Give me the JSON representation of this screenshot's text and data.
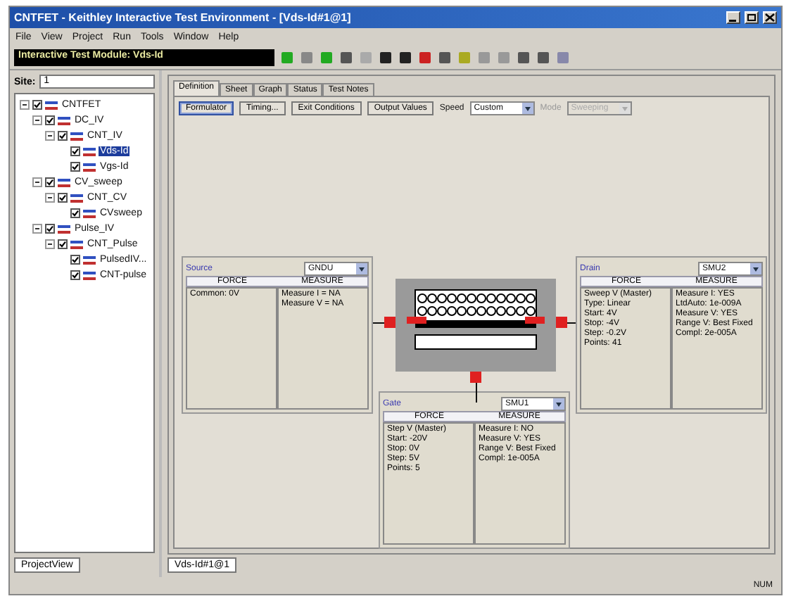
{
  "window": {
    "title": "CNTFET - Keithley Interactive Test Environment - [Vds-Id#1@1]"
  },
  "menu": [
    "File",
    "View",
    "Project",
    "Run",
    "Tools",
    "Window",
    "Help"
  ],
  "toolbar": {
    "module_label": "Interactive Test Module: Vds-Id"
  },
  "sidebar": {
    "site_label": "Site:",
    "site_value": "1",
    "tree": [
      {
        "label": "CNTFET",
        "checked": true,
        "expanded": true,
        "selected": false,
        "children": [
          {
            "label": "DC_IV",
            "checked": true,
            "expanded": true,
            "selected": false,
            "children": [
              {
                "label": "CNT_IV",
                "checked": true,
                "expanded": true,
                "selected": false,
                "children": [
                  {
                    "label": "Vds-Id",
                    "checked": true,
                    "selected": true
                  },
                  {
                    "label": "Vgs-Id",
                    "checked": true,
                    "selected": false
                  }
                ]
              }
            ]
          },
          {
            "label": "CV_sweep",
            "checked": true,
            "expanded": true,
            "selected": false,
            "children": [
              {
                "label": "CNT_CV",
                "checked": true,
                "expanded": true,
                "selected": false,
                "children": [
                  {
                    "label": "CVsweep",
                    "checked": true,
                    "selected": false
                  }
                ]
              }
            ]
          },
          {
            "label": "Pulse_IV",
            "checked": true,
            "expanded": true,
            "selected": false,
            "children": [
              {
                "label": "CNT_Pulse",
                "checked": true,
                "expanded": true,
                "selected": false,
                "children": [
                  {
                    "label": "PulsedIV...",
                    "checked": true,
                    "selected": false
                  },
                  {
                    "label": "CNT-pulse",
                    "checked": true,
                    "selected": false
                  }
                ]
              }
            ]
          }
        ]
      }
    ],
    "tab": "ProjectView"
  },
  "module": {
    "tabs": [
      {
        "label": "Definition",
        "selected": true
      },
      {
        "label": "Sheet",
        "selected": false
      },
      {
        "label": "Graph",
        "selected": false
      },
      {
        "label": "Status",
        "selected": false
      },
      {
        "label": "Test Notes",
        "selected": false
      }
    ],
    "buttons": [
      {
        "label": "Formulator",
        "selected": true
      },
      {
        "label": "Timing...",
        "selected": false
      },
      {
        "label": "Exit Conditions",
        "selected": false
      },
      {
        "label": "Output Values",
        "selected": false
      }
    ],
    "speed": {
      "label": "Speed",
      "value": "Custom"
    },
    "mode": {
      "label": "Mode",
      "value": "Sweeping",
      "disabled": true
    },
    "instruments": [
      {
        "kind": "source",
        "name": "Source",
        "unit": "GNDU",
        "force_header": "FORCE",
        "measure_header": "MEASURE",
        "force_lines": [
          "Common: 0V"
        ],
        "measure_lines": [
          "Measure I = NA",
          "Measure V = NA"
        ]
      },
      {
        "kind": "drain",
        "name": "Drain",
        "unit": "SMU2",
        "force_header": "FORCE",
        "measure_header": "MEASURE",
        "force_lines": [
          "Sweep V (Master)",
          "Type: Linear",
          "Start: 4V",
          "Stop: -4V",
          "Step: -0.2V",
          "Points: 41"
        ],
        "measure_lines": [
          "Measure I: YES",
          "LtdAuto: 1e-009A",
          "Measure V: YES",
          "Range V: Best Fixed",
          "Compl: 2e-005A"
        ]
      },
      {
        "kind": "gate",
        "name": "Gate",
        "unit": "SMU1",
        "force_header": "FORCE",
        "measure_header": "MEASURE",
        "force_lines": [
          "Step V (Master)",
          "Start: -20V",
          "Stop: 0V",
          "Step: 5V",
          "Points: 5"
        ],
        "measure_lines": [
          "Measure I: NO",
          "Measure V: YES",
          "Range V: Best Fixed",
          "Compl: 1e-005A"
        ]
      }
    ]
  },
  "document_tab": "Vds-Id#1@1",
  "status_bar": {
    "indicator": "NUM"
  }
}
